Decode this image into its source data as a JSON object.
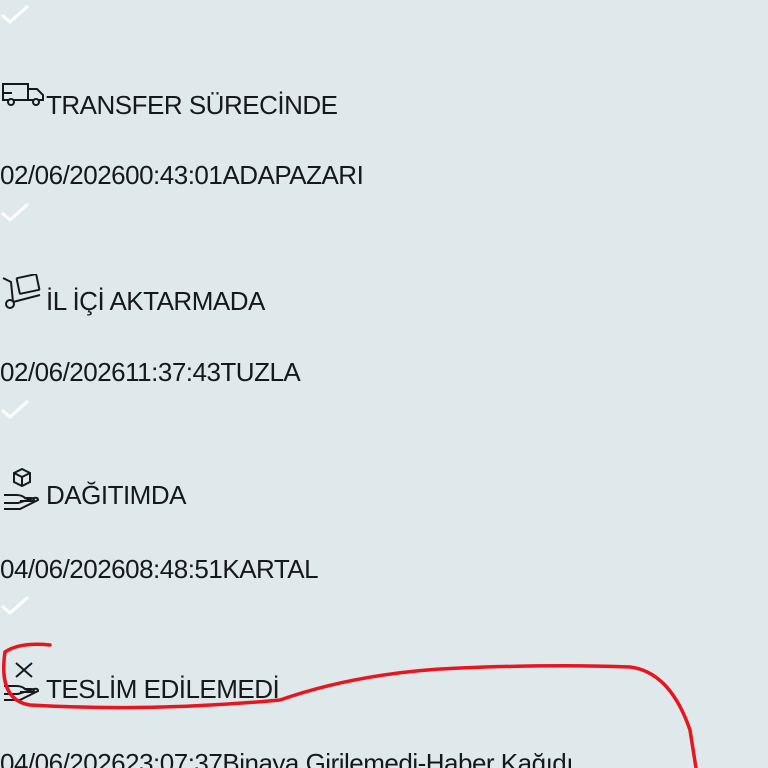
{
  "tracking": {
    "events": [
      {
        "status": "TRANSFER SÜRECİNDE",
        "icon": "truck-icon",
        "date": "02/06/2026",
        "time": "00:43:01",
        "location": "ADAPAZARI"
      },
      {
        "status": "İL İÇİ AKTARMADA",
        "icon": "hand-truck-icon",
        "date": "02/06/2026",
        "time": "11:37:43",
        "location": "TUZLA"
      },
      {
        "status": "DAĞITIMDA",
        "icon": "package-hand-icon",
        "date": "04/06/2026",
        "time": "08:48:51",
        "location": "KARTAL"
      },
      {
        "status": "TESLİM EDİLEMEDİ",
        "icon": "undelivered-hand-icon",
        "date": "04/06/2026",
        "time": "23:07:37",
        "location": "Binaya Girilemedi-Haber Kağıdı"
      }
    ]
  },
  "colors": {
    "background": "#dfe8ea",
    "text": "#16191c",
    "check": "#ffffff",
    "annotation": "#e8141e"
  }
}
